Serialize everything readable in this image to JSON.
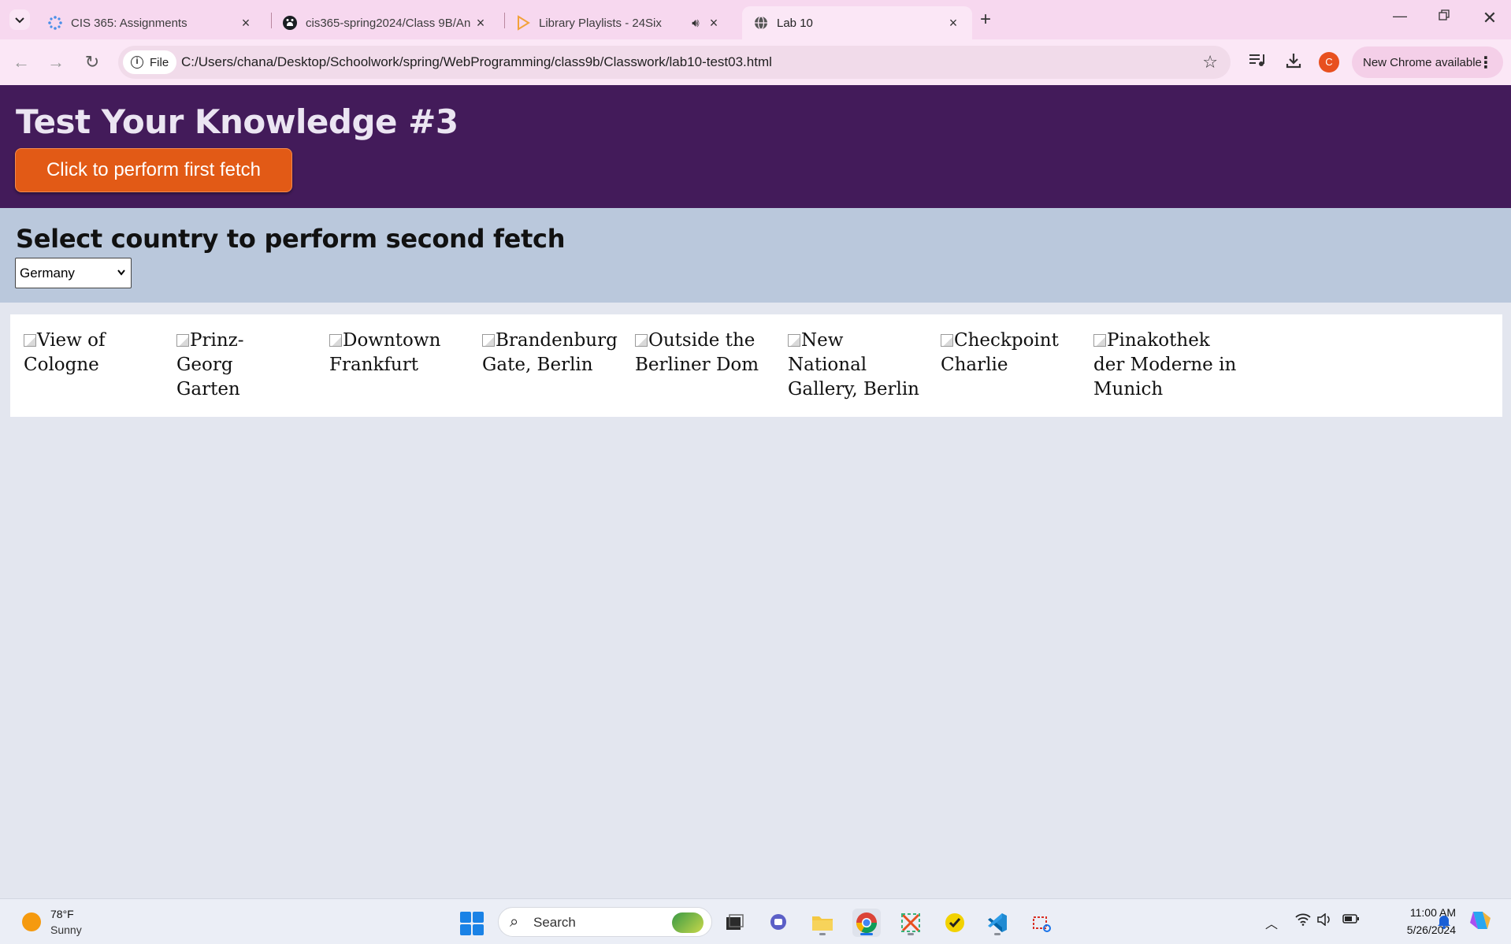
{
  "browser": {
    "tabs": [
      {
        "title": "CIS 365: Assignments",
        "icon": "canvas-icon",
        "has_audio": false,
        "active": false
      },
      {
        "title": "cis365-spring2024/Class 9B/An",
        "icon": "github-icon",
        "has_audio": false,
        "active": false
      },
      {
        "title": "Library Playlists - 24Six",
        "icon": "play-icon",
        "has_audio": true,
        "active": false
      },
      {
        "title": "Lab 10",
        "icon": "globe-icon",
        "has_audio": false,
        "active": true
      }
    ],
    "address": {
      "scheme_label": "File",
      "url": "C:/Users/chana/Desktop/Schoolwork/spring/WebProgramming/class9b/Classwork/lab10-test03.html"
    },
    "profile_initial": "C",
    "update_label": "New Chrome available"
  },
  "page": {
    "title": "Test Your Knowledge #3",
    "fetch_button": "Click to perform first fetch",
    "select_heading": "Select country to perform second fetch",
    "country_select": {
      "selected": "Germany"
    },
    "gallery": [
      {
        "alt": "View of Cologne"
      },
      {
        "alt": "Prinz-Georg Garten"
      },
      {
        "alt": "Downtown Frankfurt"
      },
      {
        "alt": "Brandenburg Gate, Berlin"
      },
      {
        "alt": "Outside the Berliner Dom"
      },
      {
        "alt": "New National Gallery, Berlin"
      },
      {
        "alt": "Checkpoint Charlie"
      },
      {
        "alt": "Pinakothek der Moderne in Munich"
      }
    ]
  },
  "taskbar": {
    "weather": {
      "temp": "78°F",
      "condition": "Sunny"
    },
    "search_label": "Search",
    "clock": {
      "time": "11:00 AM",
      "date": "5/26/2024"
    }
  },
  "colors": {
    "header_bg": "#431b5a",
    "button_orange": "#e25a16",
    "select_area_bg": "#bac8dc",
    "page_bg": "#e3e6ef",
    "tabstrip_bg": "#f7d8ef"
  }
}
